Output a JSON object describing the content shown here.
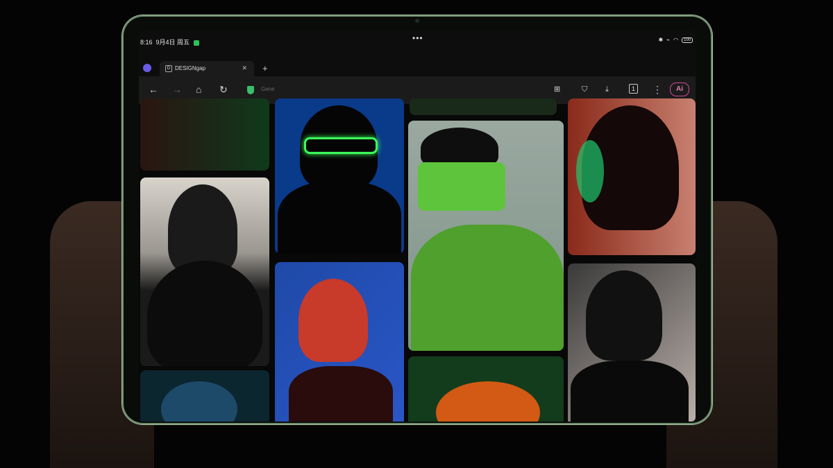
{
  "status_bar": {
    "time": "8:16",
    "date": "9月4日 周五",
    "battery": "100"
  },
  "tabs": [
    {
      "label": "DESIGNgap",
      "favicon": "D"
    }
  ],
  "toolbar": {
    "url_text": "Gene",
    "ai_label": "Ai",
    "tab_count": "1"
  },
  "icons": [
    "github-icon",
    "close-icon",
    "plus-icon",
    "back-icon",
    "forward-icon",
    "home-icon",
    "reload-icon",
    "shield-icon",
    "add-page-icon",
    "bookmark-icon",
    "download-icon",
    "tabs-icon",
    "more-icon",
    "ai-icon"
  ],
  "colors": {
    "accent_green": "#3bbd6b",
    "ai_pink": "#d84b9a",
    "bezel_green": "#8fb08c"
  },
  "gallery": {
    "items": [
      "portrait-dark-hair",
      "portrait-green-glasses",
      "portrait-green-bob",
      "portrait-blue-light",
      "portrait-red-glasses",
      "portrait-profile",
      "portrait-blue-hat",
      "portrait-orange-hair"
    ]
  }
}
